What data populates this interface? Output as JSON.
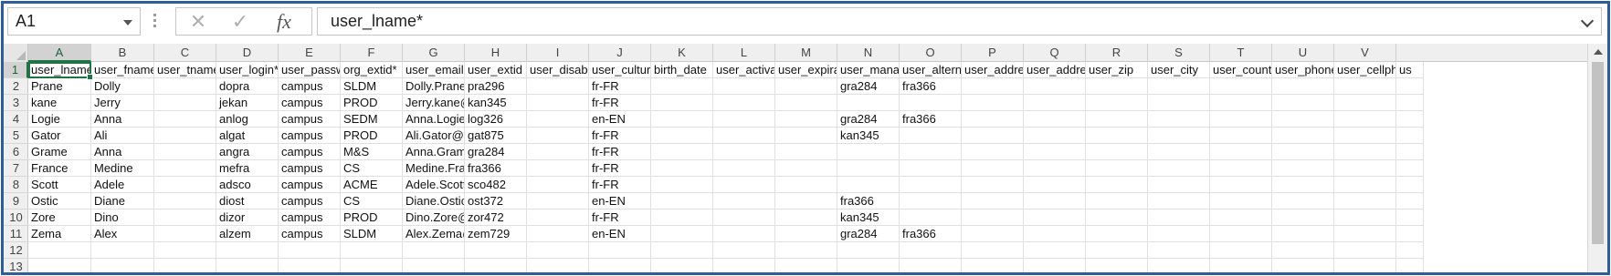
{
  "formula_bar": {
    "name_box": "A1",
    "formula": "user_lname*",
    "fx_label": "fx",
    "cancel_glyph": "✕",
    "enter_glyph": "✓"
  },
  "columns": [
    "A",
    "B",
    "C",
    "D",
    "E",
    "F",
    "G",
    "H",
    "I",
    "J",
    "K",
    "L",
    "M",
    "N",
    "O",
    "P",
    "Q",
    "R",
    "S",
    "T",
    "U",
    "V"
  ],
  "row_numbers": [
    "1",
    "2",
    "3",
    "4",
    "5",
    "6",
    "7",
    "8",
    "9",
    "10",
    "11",
    "12",
    "13"
  ],
  "sheet_rows": [
    [
      "user_lname*",
      "user_fname*",
      "user_tname",
      "user_login*",
      "user_passwo",
      "org_extid*",
      "user_email",
      "user_extid",
      "user_disable",
      "user_culture",
      "birth_date",
      "user_activati",
      "user_expirati",
      "user_manag",
      "user_alterna",
      "user_address",
      "user_address",
      "user_zip",
      "user_city",
      "user_country",
      "user_phone",
      "user_cellpho"
    ],
    [
      "Prane",
      "Dolly",
      "",
      "dopra",
      "campus",
      "SLDM",
      "Dolly.Prane@",
      "pra296",
      "",
      "fr-FR",
      "",
      "",
      "",
      "gra284",
      "fra366",
      "",
      "",
      "",
      "",
      "",
      "",
      ""
    ],
    [
      "kane",
      "Jerry",
      "",
      "jekan",
      "campus",
      "PROD",
      "Jerry.kane@",
      "kan345",
      "",
      "fr-FR",
      "",
      "",
      "",
      "",
      "",
      "",
      "",
      "",
      "",
      "",
      "",
      ""
    ],
    [
      "Logie",
      "Anna",
      "",
      "anlog",
      "campus",
      "SEDM",
      "Anna.Logie@",
      "log326",
      "",
      "en-EN",
      "",
      "",
      "",
      "gra284",
      "fra366",
      "",
      "",
      "",
      "",
      "",
      "",
      ""
    ],
    [
      "Gator",
      "Ali",
      "",
      "algat",
      "campus",
      "PROD",
      "Ali.Gator@a",
      "gat875",
      "",
      "fr-FR",
      "",
      "",
      "",
      "kan345",
      "",
      "",
      "",
      "",
      "",
      "",
      "",
      ""
    ],
    [
      "Grame",
      "Anna",
      "",
      "angra",
      "campus",
      "M&S",
      "Anna.Grame",
      "gra284",
      "",
      "fr-FR",
      "",
      "",
      "",
      "",
      "",
      "",
      "",
      "",
      "",
      "",
      "",
      ""
    ],
    [
      "France",
      "Medine",
      "",
      "mefra",
      "campus",
      "CS",
      "Medine.Fran",
      "fra366",
      "",
      "fr-FR",
      "",
      "",
      "",
      "",
      "",
      "",
      "",
      "",
      "",
      "",
      "",
      ""
    ],
    [
      "Scott",
      "Adele",
      "",
      "adsco",
      "campus",
      "ACME",
      "Adele.Scott@",
      "sco482",
      "",
      "fr-FR",
      "",
      "",
      "",
      "",
      "",
      "",
      "",
      "",
      "",
      "",
      "",
      ""
    ],
    [
      "Ostic",
      "Diane",
      "",
      "diost",
      "campus",
      "CS",
      "Diane.Ostic@",
      "ost372",
      "",
      "en-EN",
      "",
      "",
      "",
      "fra366",
      "",
      "",
      "",
      "",
      "",
      "",
      "",
      ""
    ],
    [
      "Zore",
      "Dino",
      "",
      "dizor",
      "campus",
      "PROD",
      "Dino.Zore@a",
      "zor472",
      "",
      "fr-FR",
      "",
      "",
      "",
      "kan345",
      "",
      "",
      "",
      "",
      "",
      "",
      "",
      ""
    ],
    [
      "Zema",
      "Alex",
      "",
      "alzem",
      "campus",
      "SLDM",
      "Alex.Zema@",
      "zem729",
      "",
      "en-EN",
      "",
      "",
      "",
      "gra284",
      "fra366",
      "",
      "",
      "",
      "",
      "",
      "",
      ""
    ],
    [
      "",
      "",
      "",
      "",
      "",
      "",
      "",
      "",
      "",
      "",
      "",
      "",
      "",
      "",
      "",
      "",
      "",
      "",
      "",
      "",
      "",
      ""
    ],
    [
      "",
      "",
      "",
      "",
      "",
      "",
      "",
      "",
      "",
      "",
      "",
      "",
      "",
      "",
      "",
      "",
      "",
      "",
      "",
      "",
      "",
      ""
    ]
  ],
  "overflow_text": "us",
  "colors": {
    "frame": "#2f5d99",
    "selection": "#217346"
  }
}
